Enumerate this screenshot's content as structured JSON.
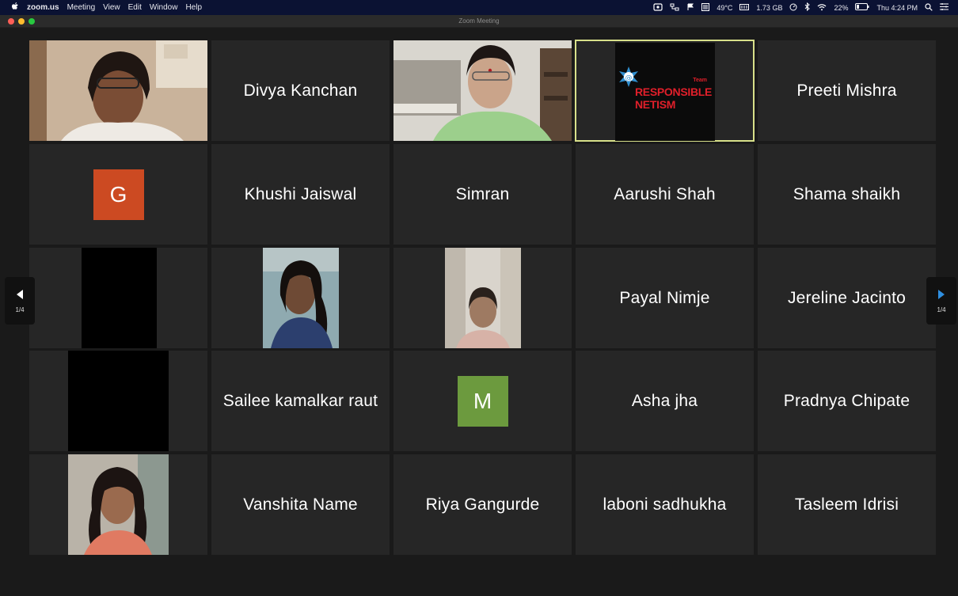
{
  "menubar": {
    "app": "zoom.us",
    "menus": [
      "Meeting",
      "View",
      "Edit",
      "Window",
      "Help"
    ],
    "status": {
      "temp": "49°C",
      "memory": "1.73 GB",
      "battery": "22%",
      "clock": "Thu 4:24 PM"
    }
  },
  "window": {
    "title": "Zoom Meeting"
  },
  "pager": {
    "left_label": "1/4",
    "right_label": "1/4"
  },
  "logo": {
    "team": "Team",
    "line1": "RESPONSIBLE",
    "line2": "NETISM"
  },
  "participants": [
    {
      "name": "",
      "kind": "video-woman-glasses"
    },
    {
      "name": "Divya Kanchan",
      "kind": "name"
    },
    {
      "name": "",
      "kind": "video-woman-bindi"
    },
    {
      "name": "",
      "kind": "logo"
    },
    {
      "name": "Preeti Mishra",
      "kind": "name"
    },
    {
      "name": "G",
      "kind": "initial",
      "color": "#cc4a22"
    },
    {
      "name": "Khushi Jaiswal",
      "kind": "name"
    },
    {
      "name": "Simran",
      "kind": "name"
    },
    {
      "name": "Aarushi Shah",
      "kind": "name"
    },
    {
      "name": "Shama shaikh",
      "kind": "name"
    },
    {
      "name": "",
      "kind": "black"
    },
    {
      "name": "",
      "kind": "video-girl-blue"
    },
    {
      "name": "",
      "kind": "video-girl-room"
    },
    {
      "name": "Payal Nimje",
      "kind": "name"
    },
    {
      "name": "Jereline Jacinto",
      "kind": "name"
    },
    {
      "name": "",
      "kind": "black"
    },
    {
      "name": "Sailee kamalkar raut",
      "kind": "name"
    },
    {
      "name": "M",
      "kind": "initial",
      "color": "#6c9a3e"
    },
    {
      "name": "Asha jha",
      "kind": "name"
    },
    {
      "name": "Pradnya Chipate",
      "kind": "name"
    },
    {
      "name": "",
      "kind": "video-girl-smile"
    },
    {
      "name": "Vanshita Name",
      "kind": "name"
    },
    {
      "name": "Riya Gangurde",
      "kind": "name"
    },
    {
      "name": "laboni sadhukha",
      "kind": "name"
    },
    {
      "name": "Tasleem Idrisi",
      "kind": "name"
    }
  ]
}
